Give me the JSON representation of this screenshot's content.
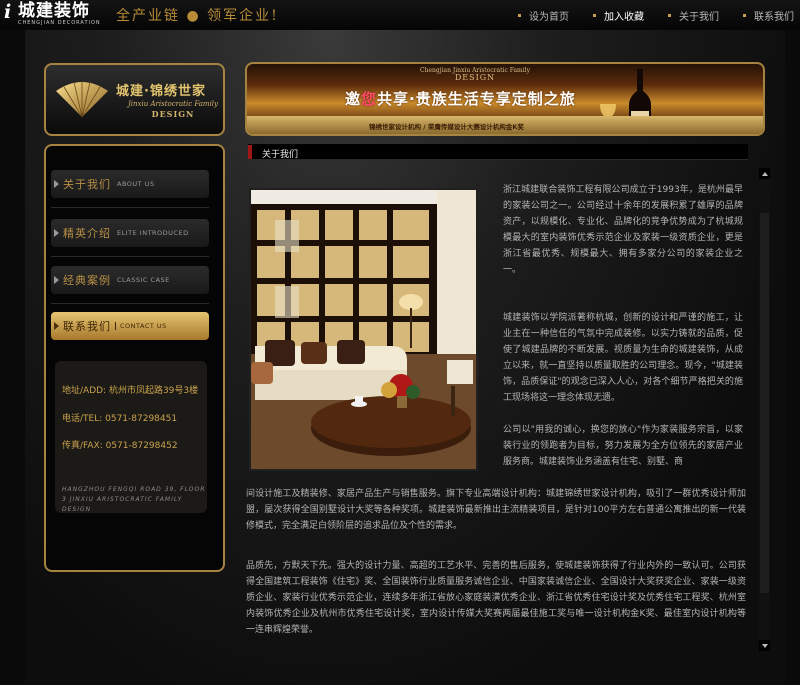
{
  "header": {
    "logo_mark": "i",
    "logo_cn": "城建装饰",
    "logo_en": "CHENGJIAN DECORATION",
    "slogan": "全产业链 ● 领军企业!",
    "nav": [
      {
        "label": "设为首页"
      },
      {
        "label": "加入收藏"
      },
      {
        "label": "关于我们"
      },
      {
        "label": "联系我们"
      }
    ]
  },
  "brand": {
    "cn": "城建·锦绣世家",
    "en_line1": "Jinxiu Aristocratic Family",
    "en_line2": "DESIGN"
  },
  "banner": {
    "en_line1": "Chengjian Jinxiu Aristocratic Family",
    "en_line2": "DESIGN",
    "main_pre": "邀",
    "main_hl": "您",
    "main_post": "共享·贵族生活专享定制之旅",
    "sub": "锦绣世家设计机构 / 荣膺传媒设计大赛设计机构金K奖"
  },
  "sidebar": {
    "items": [
      {
        "cn": "关于我们",
        "en": "ABOUT US"
      },
      {
        "cn": "精英介绍",
        "en": "ELITE INTRODUCED"
      },
      {
        "cn": "经典案例",
        "en": "CLASSIC CASE"
      },
      {
        "cn": "联系我们",
        "en": "CONTACT US"
      }
    ],
    "contact": {
      "address": "地址/ADD: 杭州市凤起路39号3楼",
      "tel": "电话/TEL: 0571-87298451",
      "fax": "传真/FAX: 0571-87298452",
      "note": "HANGZHOU FENGQI ROAD 39, FLOOR 3 JINXIU ARISTOCRATIC FAMILY DESIGN"
    }
  },
  "content": {
    "heading": "关于我们",
    "paragraphs": [
      "浙江城建联合装饰工程有限公司成立于1993年，是杭州最早的家装公司之一。公司经过十余年的发展积累了雄厚的品牌资产，以规模化、专业化、品牌化的竞争优势成为了杭城规模最大的室内装饰优秀示范企业及家装一级资质企业，更是浙江省最优秀、规模最大、拥有多家分公司的家装企业之一。",
      "城建装饰以学院派著称杭城，创新的设计和严谨的施工，让业主在一种信任的气氛中完成装修。以实力铸就的品质，促使了城建品牌的不断发展。视质量为生命的城建装饰，从成立以来，就一直坚持以质量取胜的公司理念。现今，\"城建装饰，品质保证\"的观念已深入人心，对各个细节严格把关的施工现场将这一理念体现无遗。",
      "公司以\"用我的诚心，换您的放心\"作为家装服务宗旨，以家装行业的领跑者为目标，努力发展为全方位领先的家居产业服务商。城建装饰业务涵盖有住宅、别墅、商",
      "间设计施工及精装修、家居产品生产与销售服务。旗下专业高端设计机构：城建锦绣世家设计机构，吸引了一群优秀设计师加盟，屡次获得全国别墅设计大奖等各种奖项。城建装饰最新推出主流精装项目，是针对100平方左右普通公寓推出的新一代装修模式，完全满足白领阶层的追求品位及个性的需求。",
      "品质先，方默天下先。强大的设计力量、高超的工艺水平、完善的售后服务，使城建装饰获得了行业内外的一致认可。公司获得全国建筑工程装饰《住宅》奖、全国装饰行业质量服务诚信企业、中国家装诚信企业、全国设计大奖获奖企业、家装一级资质企业、家装行业优秀示范企业，连续多年浙江省放心家庭装潢优秀企业、浙江省优秀住宅设计奖及优秀住宅工程奖、杭州室内装饰优秀企业及杭州市优秀住宅设计奖，室内设计传媒大奖赛两届最佳施工奖与唯一设计机构金K奖、最佳室内设计机构等一连串辉煌荣誉。"
    ]
  }
}
